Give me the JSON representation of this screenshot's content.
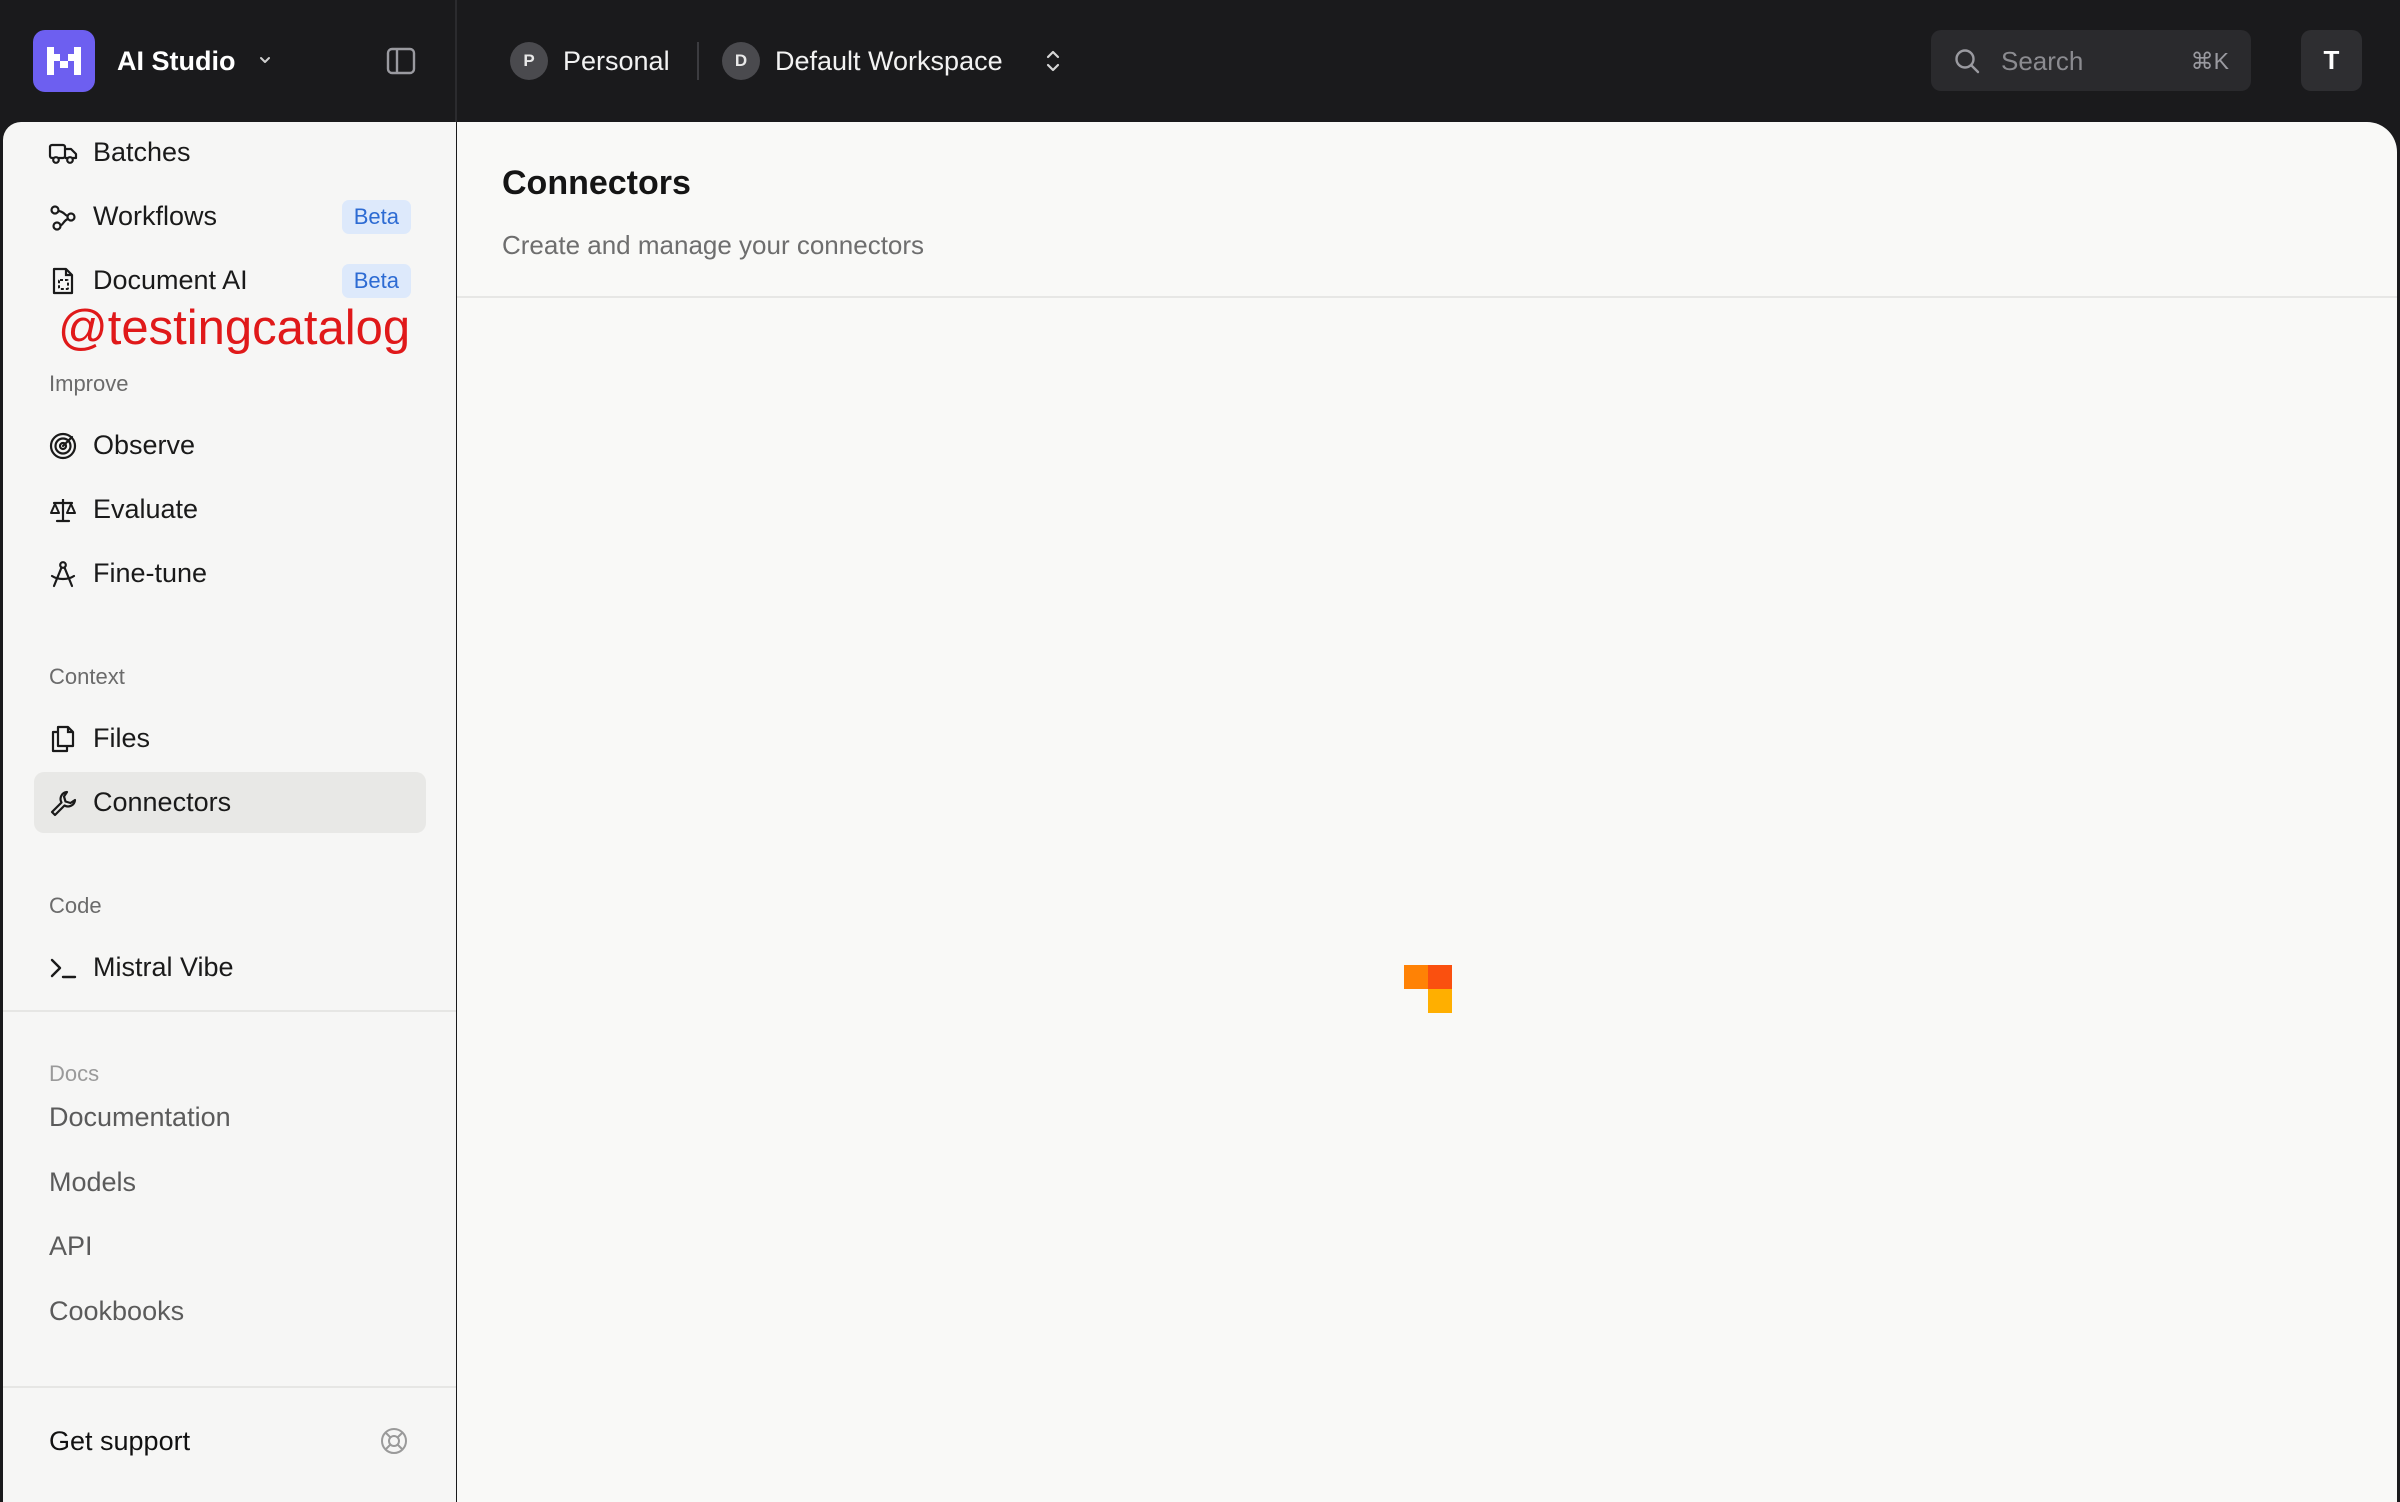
{
  "app": {
    "title": "AI Studio",
    "accent_color": "#6d5ff0"
  },
  "topbar": {
    "workspaces": [
      {
        "initial": "P",
        "label": "Personal"
      },
      {
        "initial": "D",
        "label": "Default Workspace"
      }
    ],
    "search": {
      "placeholder": "Search",
      "shortcut": "⌘K"
    },
    "user_initial": "T"
  },
  "sidebar": {
    "top_items": [
      {
        "label": "Batches",
        "icon": "truck-icon"
      },
      {
        "label": "Workflows",
        "icon": "workflow-icon",
        "badge": "Beta"
      },
      {
        "label": "Document AI",
        "icon": "document-scan-icon",
        "badge": "Beta"
      }
    ],
    "watermark": "@testingcatalog",
    "sections": [
      {
        "title": "Improve",
        "items": [
          {
            "label": "Observe",
            "icon": "radar-icon"
          },
          {
            "label": "Evaluate",
            "icon": "scale-icon"
          },
          {
            "label": "Fine-tune",
            "icon": "compass-icon"
          }
        ]
      },
      {
        "title": "Context",
        "items": [
          {
            "label": "Files",
            "icon": "files-icon"
          },
          {
            "label": "Connectors",
            "icon": "wrench-icon",
            "active": true
          }
        ]
      },
      {
        "title": "Code",
        "items": [
          {
            "label": "Mistral Vibe",
            "icon": "terminal-icon"
          }
        ]
      }
    ],
    "docs": {
      "title": "Docs",
      "links": [
        "Documentation",
        "Models",
        "API",
        "Cookbooks"
      ]
    },
    "support": {
      "label": "Get support",
      "icon": "lifebuoy-icon"
    }
  },
  "main": {
    "title": "Connectors",
    "subtitle": "Create and manage your connectors",
    "loading": true,
    "spinner_colors": [
      "#ff8205",
      "#fa500f",
      "#ffaf00"
    ]
  }
}
